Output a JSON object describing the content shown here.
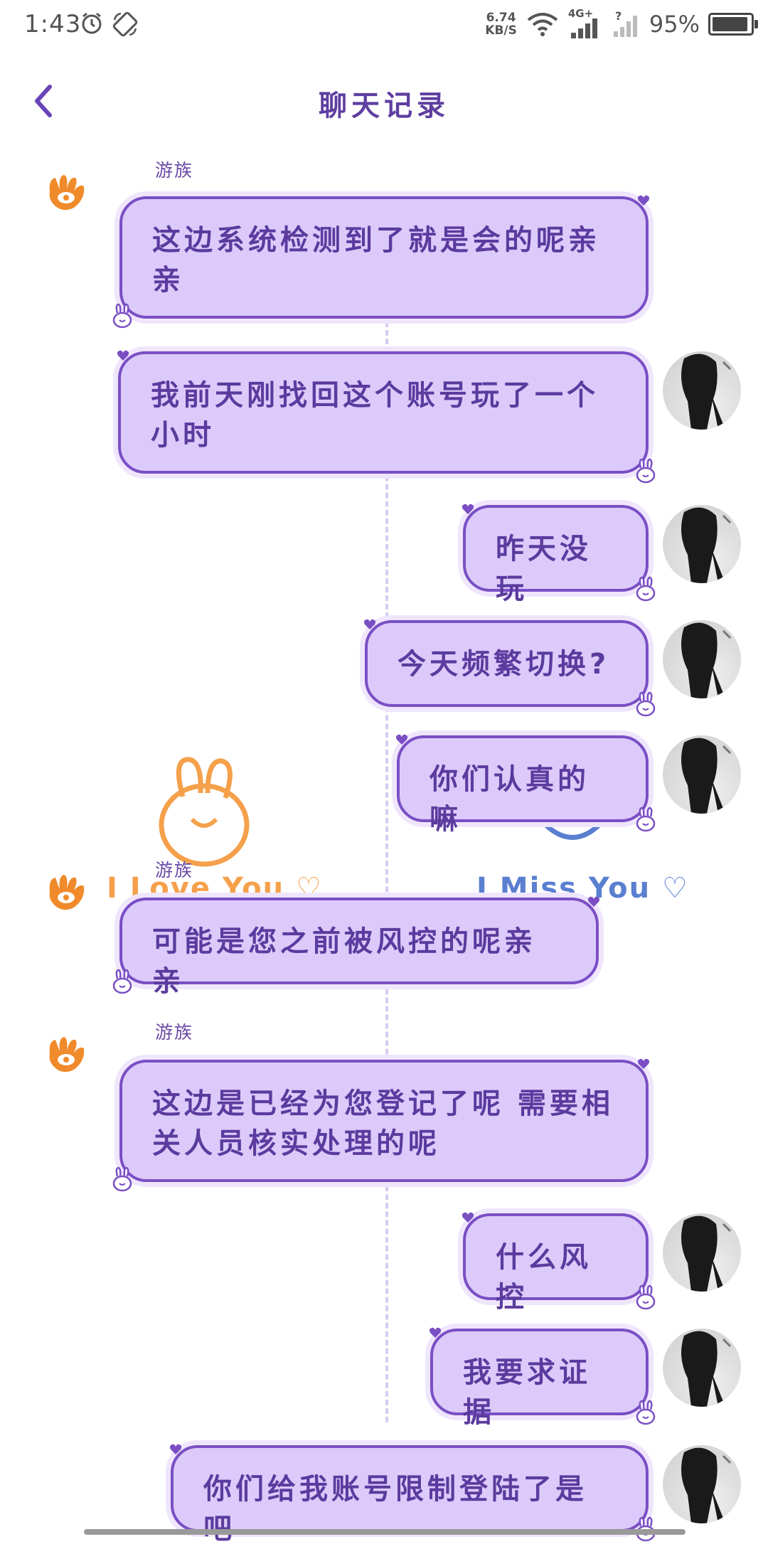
{
  "status_bar": {
    "time": "1:43",
    "net_speed": "6.74",
    "net_unit": "KB/S",
    "network": "4G+",
    "battery_percent": "95%",
    "battery_level": 0.95
  },
  "header": {
    "title": "聊天记录",
    "back_icon": "chevron-left-icon"
  },
  "colors": {
    "accent": "#5e3fa0",
    "bubble_fill": "#dccbfa",
    "bubble_border": "#7a4fc4",
    "agent_icon": "#f08a2a",
    "sticker_orange": "#f5a04a",
    "sticker_blue": "#5a7fd0"
  },
  "stickers": {
    "left_text": "I Love You ♡",
    "right_text": "I Miss You ♡"
  },
  "messages": [
    {
      "side": "left",
      "sender": "游族",
      "text": "这边系统检测到了就是会的呢亲亲"
    },
    {
      "side": "right",
      "text": "我前天刚找回这个账号玩了一个小时"
    },
    {
      "side": "right",
      "text": "昨天没玩"
    },
    {
      "side": "right",
      "text": "今天频繁切换?"
    },
    {
      "side": "right",
      "text": "你们认真的嘛"
    },
    {
      "side": "left",
      "sender": "游族",
      "text": "可能是您之前被风控的呢亲亲"
    },
    {
      "side": "left",
      "sender": "游族",
      "text": "这边是已经为您登记了呢 需要相关人员核实处理的呢"
    },
    {
      "side": "right",
      "text": "什么风控"
    },
    {
      "side": "right",
      "text": "我要求证据"
    },
    {
      "side": "right",
      "text": "你们给我账号限制登陆了是吧"
    }
  ]
}
